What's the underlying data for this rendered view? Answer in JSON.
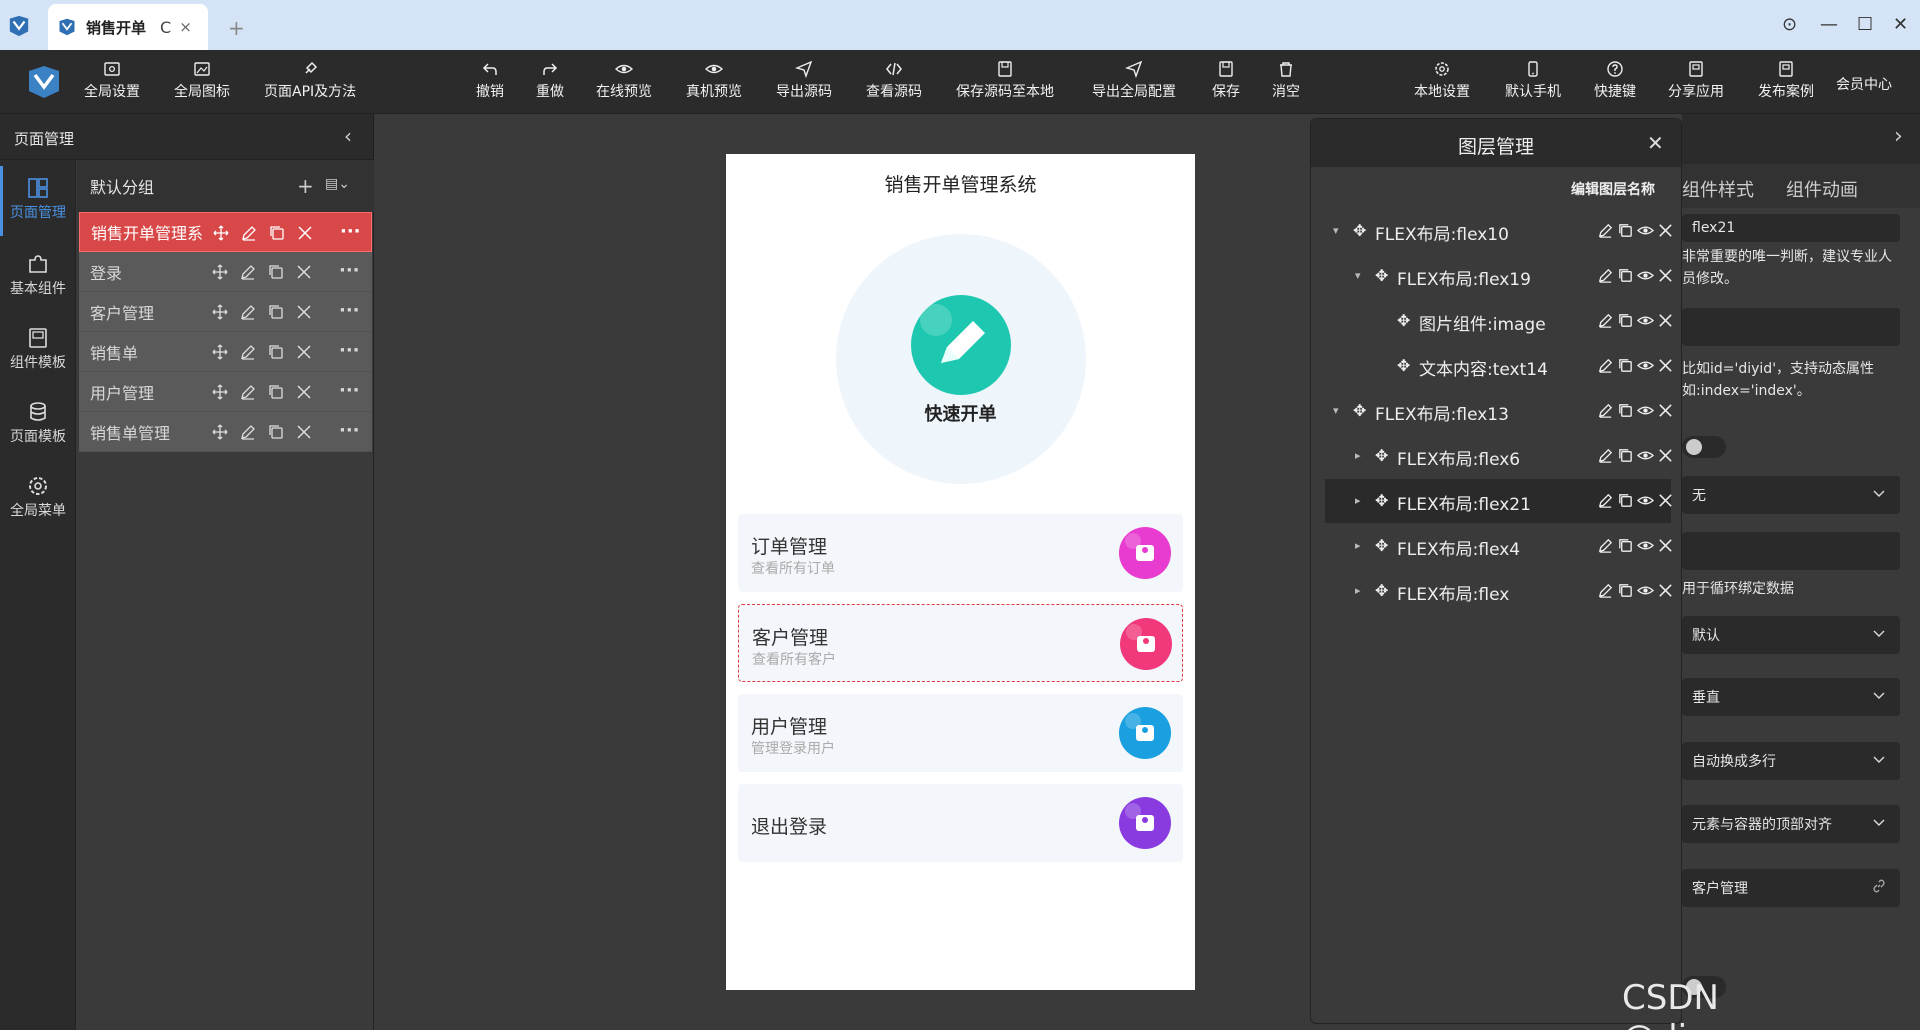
{
  "tab": {
    "title": "销售开单",
    "refresh": "C",
    "close": "×",
    "add": "+"
  },
  "window": {
    "settings": "⊙",
    "minimize": "—",
    "maximize": "☐",
    "close": "✕"
  },
  "toolbar": {
    "left": [
      "全局设置",
      "全局图标",
      "页面API及方法"
    ],
    "center": [
      "撤销",
      "重做",
      "在线预览",
      "真机预览",
      "导出源码",
      "查看源码",
      "保存源码至本地",
      "导出全局配置",
      "保存",
      "消空"
    ],
    "right": [
      "本地设置",
      "默认手机",
      "快捷键",
      "分享应用",
      "发布案例"
    ],
    "vip": "会员中心"
  },
  "left_panel": {
    "title": "页面管理",
    "rail": [
      "页面管理",
      "基本组件",
      "组件模板",
      "页面模板",
      "全局菜单"
    ],
    "group": "默认分组",
    "pages": [
      "销售开单管理系",
      "登录",
      "客户管理",
      "销售单",
      "用户管理",
      "销售单管理"
    ]
  },
  "phone": {
    "title": "销售开单管理系统",
    "hero_label": "快速开单",
    "cards": [
      {
        "title": "订单管理",
        "subtitle": "查看所有订单",
        "color": "#e83bcf"
      },
      {
        "title": "客户管理",
        "subtitle": "查看所有客户",
        "color": "#f0387a"
      },
      {
        "title": "用户管理",
        "subtitle": "管理登录用户",
        "color": "#1a9fe0"
      },
      {
        "title": "退出登录",
        "subtitle": "",
        "color": "#8a3be0"
      }
    ]
  },
  "layers": {
    "title": "图层管理",
    "edit_label": "编辑图层名称",
    "close": "✕",
    "items": [
      {
        "label": "FLEX布局:flex10",
        "depth": 0,
        "arrow": "▾"
      },
      {
        "label": "FLEX布局:flex19",
        "depth": 1,
        "arrow": "▾"
      },
      {
        "label": "图片组件:image",
        "depth": 2,
        "arrow": ""
      },
      {
        "label": "文本内容:text14",
        "depth": 2,
        "arrow": ""
      },
      {
        "label": "FLEX布局:flex13",
        "depth": 0,
        "arrow": "▾"
      },
      {
        "label": "FLEX布局:flex6",
        "depth": 1,
        "arrow": "▸"
      },
      {
        "label": "FLEX布局:flex21",
        "depth": 1,
        "arrow": "▸",
        "active": true
      },
      {
        "label": "FLEX布局:flex4",
        "depth": 1,
        "arrow": "▸"
      },
      {
        "label": "FLEX布局:flex",
        "depth": 1,
        "arrow": "▸"
      }
    ]
  },
  "props": {
    "tabs": [
      "组件样式",
      "组件动画"
    ],
    "field_top": "flex21",
    "hint1": "非常重要的唯一判断，建议专业人员修改。",
    "hint2": "比如id='diyid'，支持动态属性如:index='index'。",
    "select_none": "无",
    "hint3": "用于循环绑定数据",
    "select_default": "默认",
    "select_vertical": "垂直",
    "select_wrap": "自动换成多行",
    "select_align": "元素与容器的顶部对齐",
    "link_field": "客户管理"
  },
  "watermark": "CSDN @diygwcom"
}
